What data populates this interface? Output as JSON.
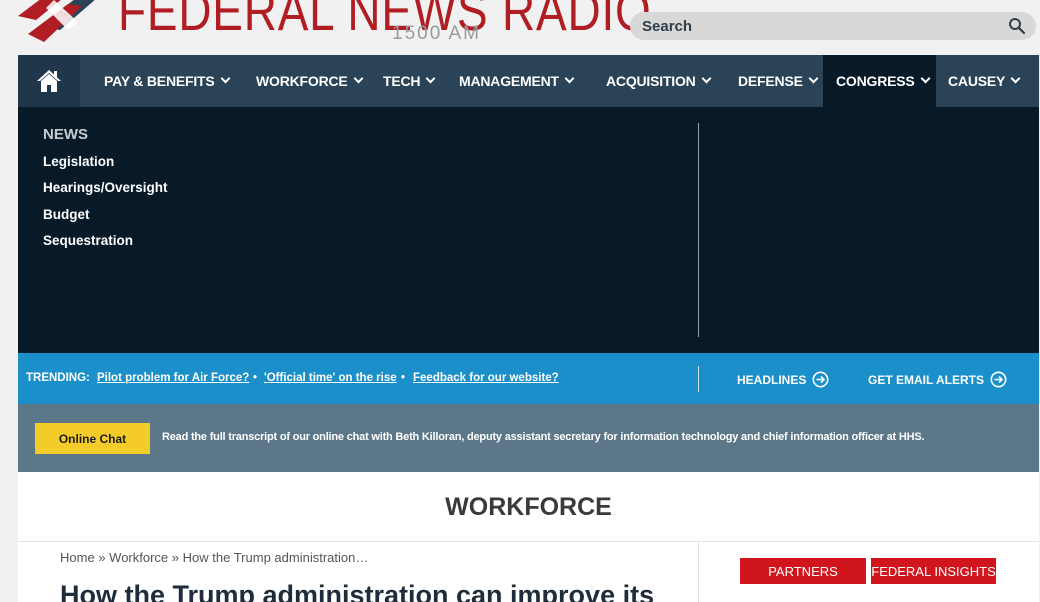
{
  "header": {
    "logo_text": "FEDERAL NEWS RADIO",
    "logo_sub": "1500 AM",
    "search_label": "Search"
  },
  "nav": {
    "items": [
      {
        "label": "PAY & BENEFITS"
      },
      {
        "label": "WORKFORCE"
      },
      {
        "label": "TECH"
      },
      {
        "label": "MANAGEMENT"
      },
      {
        "label": "ACQUISITION"
      },
      {
        "label": "DEFENSE"
      },
      {
        "label": "CONGRESS",
        "active": true
      },
      {
        "label": "CAUSEY"
      }
    ]
  },
  "dropdown": {
    "heading": "NEWS",
    "links": [
      "Legislation",
      "Hearings/Oversight",
      "Budget",
      "Sequestration"
    ]
  },
  "trending": {
    "label": "TRENDING:",
    "links": [
      "Pilot problem for Air Force?",
      "'Official time' on the rise",
      "Feedback for our website?"
    ],
    "headlines": "HEADLINES",
    "alerts": "GET EMAIL ALERTS"
  },
  "chat": {
    "button": "Online Chat",
    "text": "Read the full transcript of our online chat with Beth Killoran, deputy assistant secretary for information technology and chief information officer at HHS."
  },
  "content": {
    "section_title": "WORKFORCE",
    "breadcrumb": [
      "Home",
      "Workforce",
      "How the Trump administration…"
    ],
    "breadcrumb_sep": "»",
    "headline": "How the Trump administration can improve its",
    "partners": "PARTNERS",
    "federal_insights": "FEDERAL INSIGHTS"
  },
  "colors": {
    "brand_red": "#b01e23",
    "nav_bg": "#2a4356",
    "dropdown_bg": "#081a28",
    "trending_bg": "#1b8fc9",
    "chat_bg": "#5b7788",
    "chat_button": "#f4cc2a",
    "red_button": "#d0161c"
  }
}
